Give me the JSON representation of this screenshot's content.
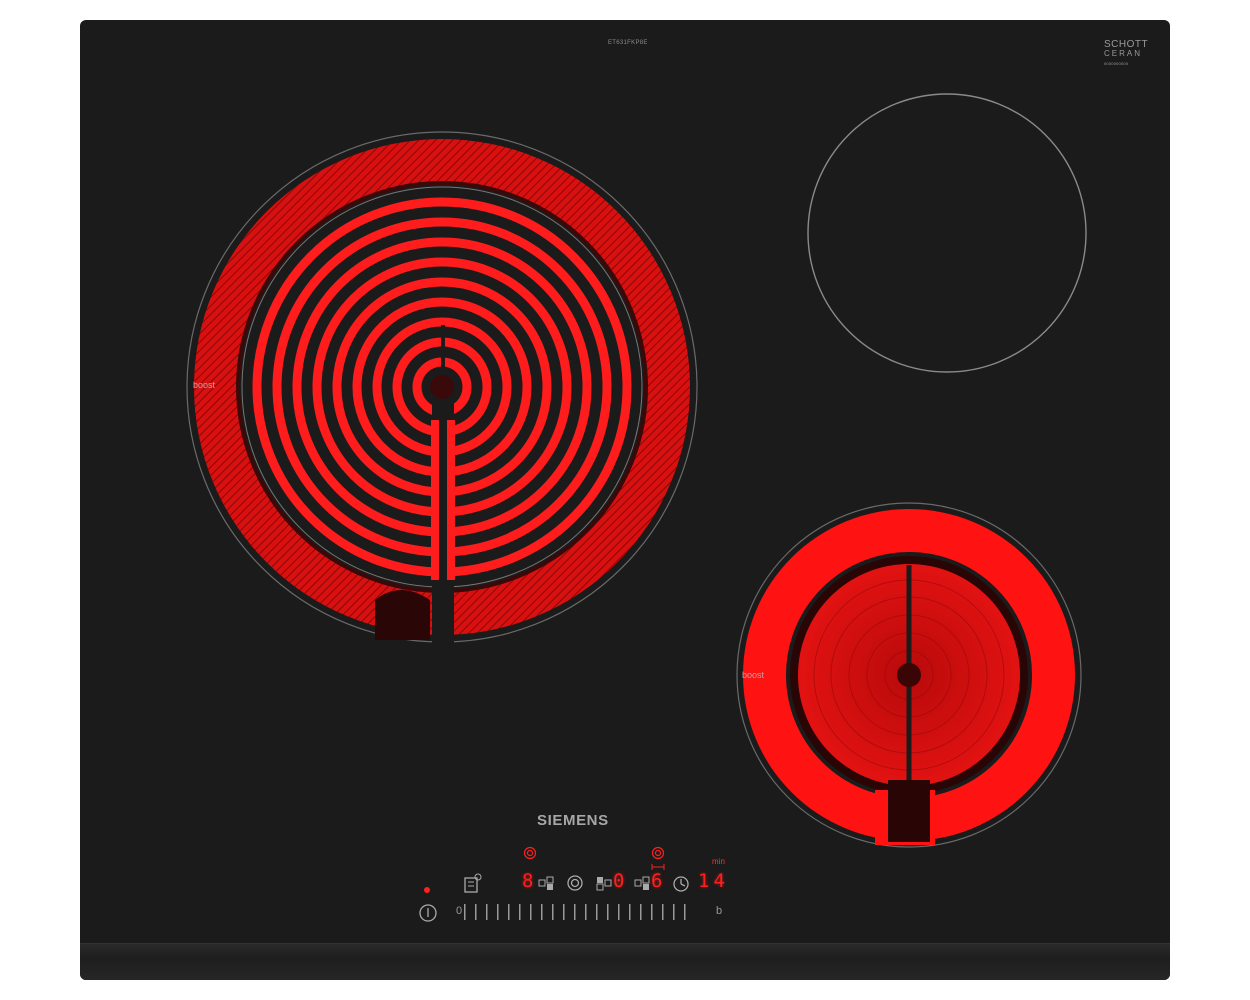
{
  "hob": {
    "model": "ET631FKP8E",
    "ceramic_brand_line1": "SCHOTT",
    "ceramic_brand_line2": "CERAN",
    "ceramic_brand_small": "0000000000",
    "manufacturer": "SIEMENS",
    "zone_left_label": "boost",
    "zone_right_label": "boost"
  },
  "control_panel": {
    "zone_1_level": "8",
    "zone_2_level": "0",
    "zone_3_level": "6",
    "timer_minutes": "14",
    "timer_unit": "min",
    "slider_min": "0",
    "slider_max": "b",
    "icons": [
      "power-icon",
      "child-lock-icon",
      "zone-select-icon",
      "dual-zone-icon",
      "timer-clock-icon"
    ]
  },
  "colors": {
    "glass": "#1b1b1b",
    "heat_red": "#ff1414",
    "display_red": "#ff1f1f"
  }
}
